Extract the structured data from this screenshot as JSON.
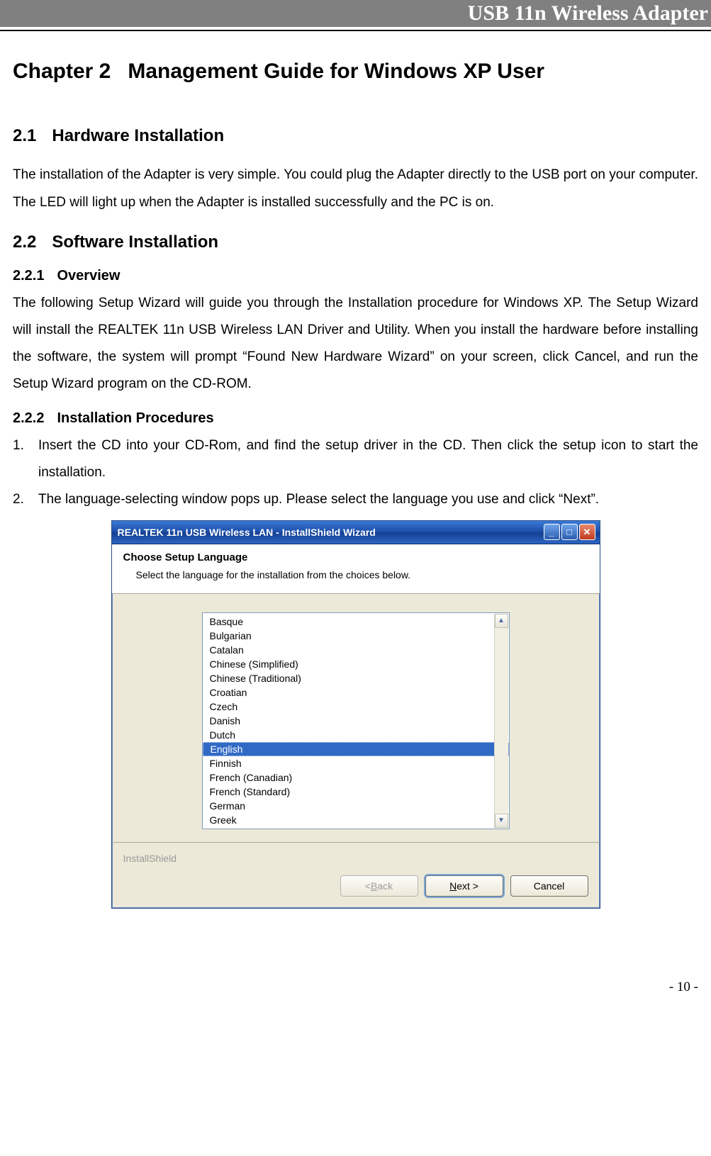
{
  "header_banner": "USB 11n Wireless Adapter",
  "chapter": {
    "number": "Chapter 2",
    "title": "Management Guide for Windows XP User"
  },
  "s21": {
    "num": "2.1",
    "title": "Hardware Installation",
    "para": "The installation of the Adapter is very simple. You could plug the Adapter directly to the USB port on your computer. The LED will light up when the Adapter is installed successfully and the PC is on."
  },
  "s22": {
    "num": "2.2",
    "title": "Software Installation"
  },
  "s221": {
    "num": "2.2.1",
    "title": "Overview",
    "para": "The following Setup Wizard will guide you through the Installation procedure for Windows XP. The Setup Wizard will install the REALTEK 11n USB Wireless LAN Driver and Utility. When you install the hardware before installing the software, the system will prompt “Found New Hardware Wizard” on your screen, click Cancel, and run the Setup Wizard program on the CD-ROM."
  },
  "s222": {
    "num": "2.2.2",
    "title": "Installation Procedures",
    "items": [
      "Insert the CD into your CD-Rom, and find the setup driver in the CD. Then click the setup icon to start the installation.",
      "The language-selecting window pops up. Please select the language you use and click “Next”."
    ]
  },
  "wizard": {
    "window_title": "REALTEK 11n USB Wireless LAN - InstallShield Wizard",
    "banner_title": "Choose Setup Language",
    "banner_sub": "Select the language for the installation from the choices below.",
    "languages": [
      "Basque",
      "Bulgarian",
      "Catalan",
      "Chinese (Simplified)",
      "Chinese (Traditional)",
      "Croatian",
      "Czech",
      "Danish",
      "Dutch",
      "English",
      "Finnish",
      "French (Canadian)",
      "French (Standard)",
      "German",
      "Greek"
    ],
    "selected_index": 9,
    "footer_brand": "InstallShield",
    "buttons": {
      "back_prefix": "< ",
      "back_accel": "B",
      "back_rest": "ack",
      "next_accel": "N",
      "next_rest": "ext >",
      "cancel": "Cancel"
    }
  },
  "page_number": "- 10 -"
}
